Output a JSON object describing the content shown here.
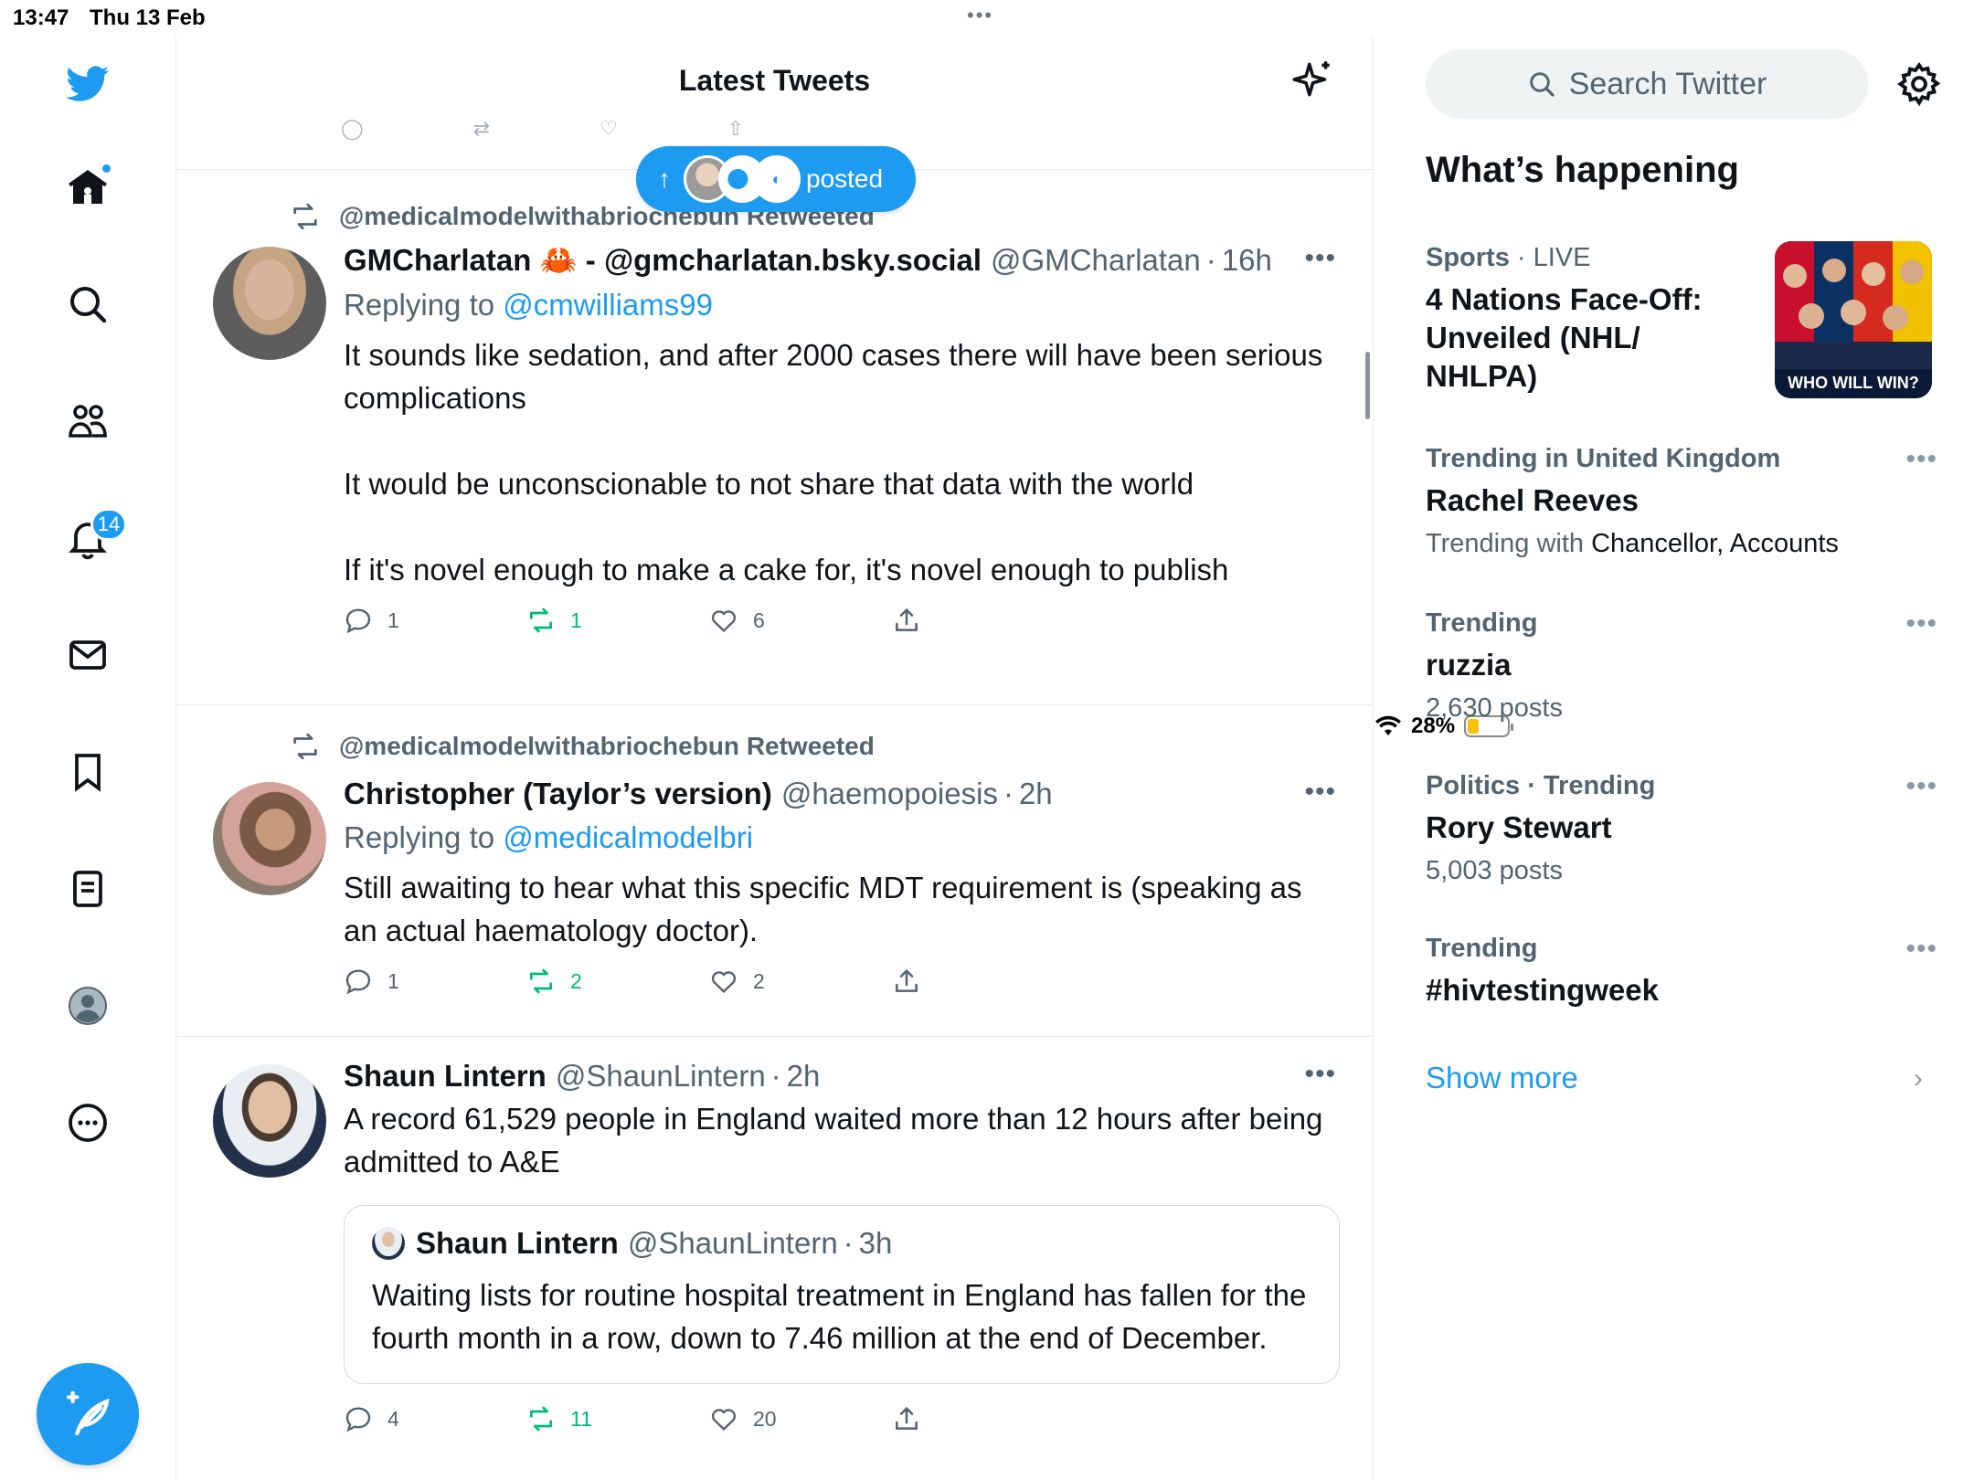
{
  "status_bar": {
    "time": "13:47",
    "date": "Thu 13 Feb",
    "battery": "28%",
    "battery_level": 0.28
  },
  "nav": {
    "items": [
      "twitter-logo",
      "home-icon",
      "search-icon",
      "communities-icon",
      "notifications-icon",
      "messages-icon",
      "bookmarks-icon",
      "lists-icon",
      "profile-icon",
      "more-icon"
    ],
    "notifications_count": "14",
    "accent": "#1d9bf0"
  },
  "timeline": {
    "title": "Latest Tweets",
    "new_posts_label": "posted",
    "tweets": [
      {
        "retweeted_by": "@medicalmodelwithabriochebun Retweeted",
        "name": "GMCharlatan 🦀 - @gmcharlatan.bsky.social",
        "handle": "@GMCharlatan",
        "time": "16h",
        "reply_prefix": "Replying to ",
        "reply_to": "@cmwilliams99",
        "text": "It sounds like sedation, and after 2000 cases there will have been serious complications\n\nIt would be unconscionable to not share that data with the world\n\nIf it's novel enough to make a cake for, it's novel enough to publish",
        "replies": "1",
        "retweets": "1",
        "likes": "6"
      },
      {
        "retweeted_by": "@medicalmodelwithabriochebun Retweeted",
        "name": "Christopher (Taylor’s version)",
        "handle": "@haemopoiesis",
        "time": "2h",
        "reply_prefix": "Replying to ",
        "reply_to": "@medicalmodelbri",
        "text": "Still awaiting to hear what this specific MDT requirement is (speaking as an actual haematology doctor).",
        "replies": "1",
        "retweets": "2",
        "likes": "2"
      },
      {
        "name": "Shaun Lintern",
        "handle": "@ShaunLintern",
        "time": "2h",
        "text": "A record 61,529 people in England waited more than 12 hours after being admitted to A&E",
        "quote": {
          "name": "Shaun Lintern",
          "handle": "@ShaunLintern",
          "time": "3h",
          "text": "Waiting lists for routine hospital treatment in England has fallen for the fourth month in a row, down to 7.46 million at the end of December."
        },
        "replies": "4",
        "retweets": "11",
        "likes": "20"
      }
    ]
  },
  "sidebar": {
    "search_placeholder": "Search Twitter",
    "section_title": "What’s happening",
    "trends": [
      {
        "category": "Sports",
        "context": "LIVE",
        "title": "4 Nations Face-Off: Unveiled (NHL/ NHLPA)",
        "thumb_caption": "WHO WILL WIN?"
      },
      {
        "category": "Trending in United Kingdom",
        "title": "Rachel Reeves",
        "sub_prefix": "Trending with ",
        "sub_value": "Chancellor, Accounts"
      },
      {
        "category": "Trending",
        "title": "ruzzia",
        "sub": "2,630 posts"
      },
      {
        "category": "Politics · Trending",
        "title": "Rory Stewart",
        "sub": "5,003 posts"
      },
      {
        "category": "Trending",
        "title": "#hivtestingweek"
      }
    ],
    "show_more": "Show more"
  }
}
